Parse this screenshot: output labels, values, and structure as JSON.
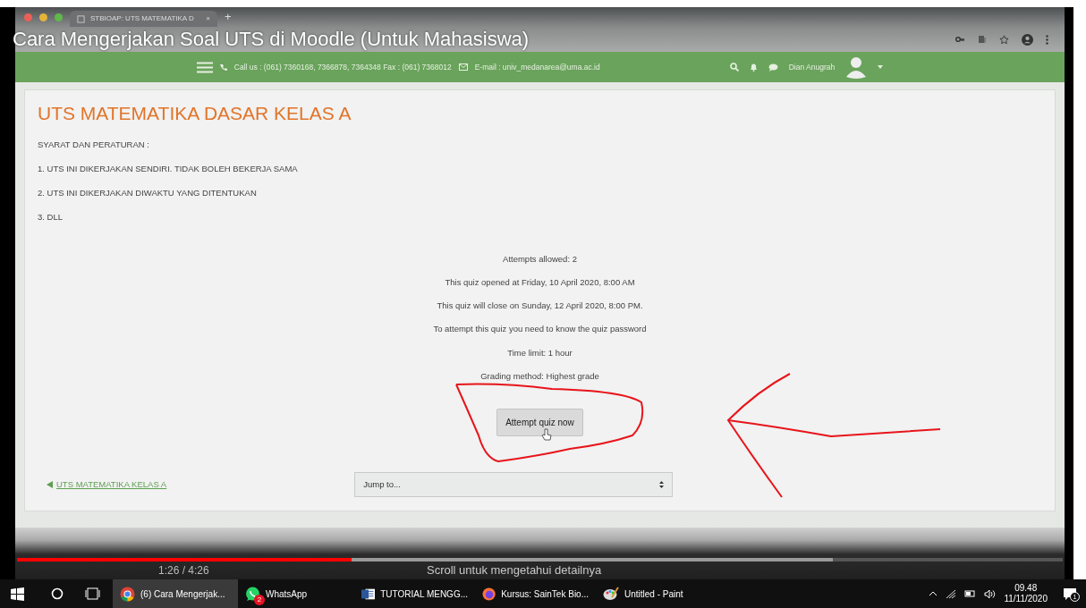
{
  "video": {
    "title": "Cara Mengerjakan Soal UTS di Moodle (Untuk Mahasiswa)",
    "elapsed": "1:26 / 4:26",
    "caption": "Scroll untuk mengetahui detailnya",
    "played": {
      "level": 0.32
    },
    "buffered": {
      "level": 0.78
    }
  },
  "browser": {
    "tab_title": "STBIOAP: UTS MATEMATIKA D",
    "tab_close": "×",
    "new_tab": "+"
  },
  "navbar": {
    "contact": "Call us : (061) 7360168, 7366878, 7364348 Fax : (061) 7368012",
    "email": "E-mail : univ_medanarea@uma.ac.id",
    "user_name": "Dian Anugrah"
  },
  "quiz": {
    "title": "UTS MATEMATIKA DASAR KELAS A",
    "rules": [
      "SYARAT DAN PERATURAN :",
      "1. UTS INI DIKERJAKAN SENDIRI. TIDAK BOLEH BEKERJA SAMA",
      "2. UTS INI DIKERJAKAN DIWAKTU YANG DITENTUKAN",
      "3. DLL"
    ],
    "info": [
      "Attempts allowed: 2",
      "This quiz opened at Friday, 10 April 2020, 8:00 AM",
      "This quiz will close on Sunday, 12 April 2020, 8:00 PM.",
      "To attempt this quiz you need to know the quiz password",
      "Time limit: 1 hour",
      "Grading method: Highest grade"
    ],
    "attempt_button": "Attempt quiz now",
    "back_link": "UTS MATEMATIKA KELAS A",
    "jump_select": "Jump to..."
  },
  "taskbar": {
    "items": [
      {
        "kind": "chrome",
        "label": "(6) Cara Mengerjak...",
        "selected": true
      },
      {
        "kind": "whatsapp",
        "label": "WhatsApp",
        "badge": "2",
        "selected": false
      },
      {
        "kind": "word",
        "label": "TUTORIAL MENGG...",
        "selected": false
      },
      {
        "kind": "firefox",
        "label": "Kursus: SainTek Bio...",
        "selected": false
      },
      {
        "kind": "paint",
        "label": "Untitled - Paint",
        "selected": false
      }
    ],
    "time": "09.48",
    "date": "11/11/2020",
    "notifications": "1"
  }
}
